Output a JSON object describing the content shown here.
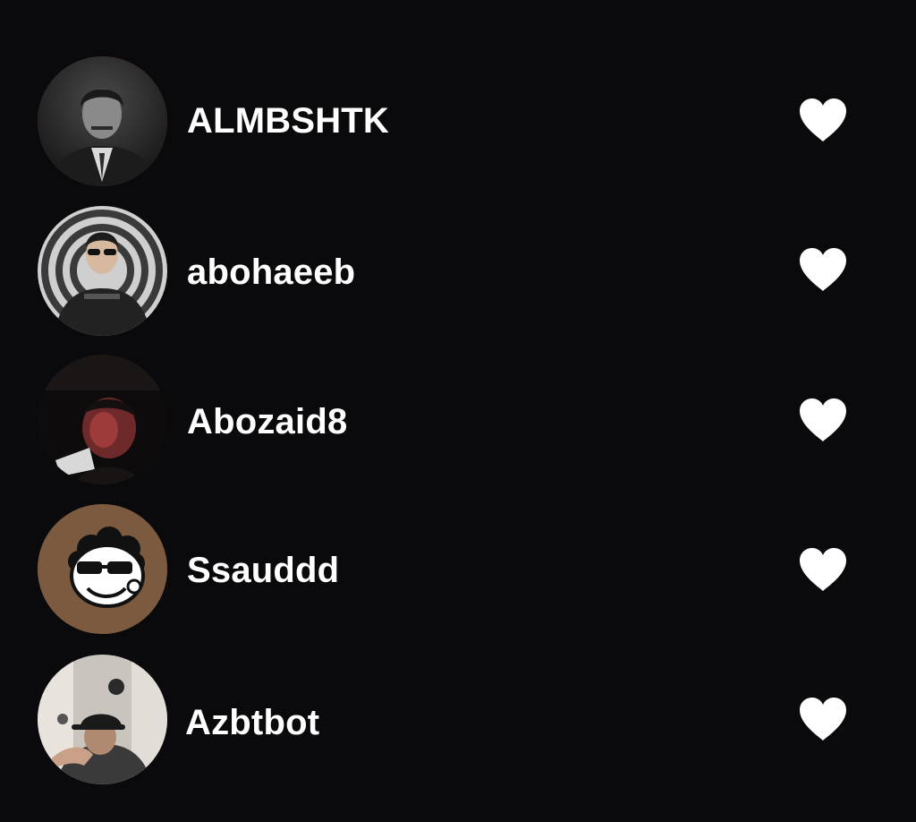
{
  "screen": {
    "background": "#0a0a0c",
    "heart_color": "#ffffff"
  },
  "users": [
    {
      "username": "ALMBSHTK",
      "avatar": "avatar-photo-suit",
      "story_ring": true,
      "ring_color": "#c0262c"
    },
    {
      "username": "abohaeeb",
      "avatar": "avatar-photo-hoodie-spiral",
      "story_ring": false
    },
    {
      "username": "Abozaid8",
      "avatar": "avatar-photo-dark-red-light",
      "story_ring": false
    },
    {
      "username": "Ssauddd",
      "avatar": "avatar-cartoon-sunglasses",
      "story_ring": false,
      "avatar_bg": "#7b5a3f"
    },
    {
      "username": "Azbtbot",
      "avatar": "avatar-photo-cap-selfie",
      "story_ring": false
    }
  ],
  "actions": {
    "like_icon": "heart-icon"
  }
}
